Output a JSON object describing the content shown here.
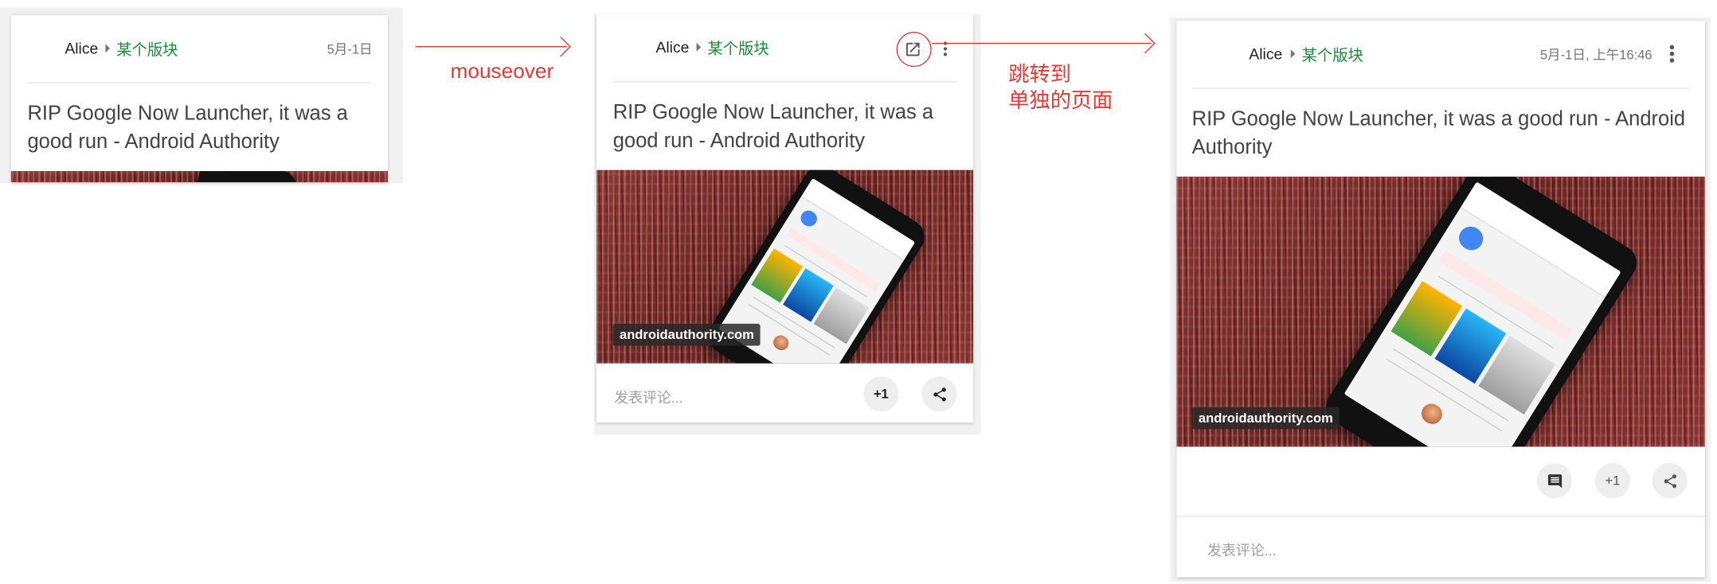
{
  "cards": {
    "card1": {
      "author": "Alice",
      "board": "某个版块",
      "date": "5月-1日",
      "title": "RIP Google Now Launcher, it was a good run - Android Authority"
    },
    "card2": {
      "author": "Alice",
      "board": "某个版块",
      "title": "RIP Google Now Launcher, it was a good run - Android Authority",
      "source": "androidauthority.com",
      "comment_placeholder": "发表评论...",
      "plus_one": "+1"
    },
    "card3": {
      "author": "Alice",
      "board": "某个版块",
      "date": "5月-1日, 上午16:46",
      "title": "RIP Google Now Launcher, it was a good run - Android Authority",
      "source": "androidauthority.com",
      "comment_placeholder": "发表评论...",
      "plus_one": "+1"
    }
  },
  "annotations": {
    "mouseover": "mouseover",
    "jump_line1": "跳转到",
    "jump_line2": "单独的页面"
  },
  "icons": {
    "open_in_new": "open-in-new-icon",
    "more": "more-vert-icon",
    "share": "share-icon",
    "comment": "comment-icon"
  },
  "colors": {
    "board_green": "#1b8a3a",
    "annotation_red": "#e53935",
    "card_background": "#ffffff",
    "panel_background": "#f1f1f1"
  }
}
